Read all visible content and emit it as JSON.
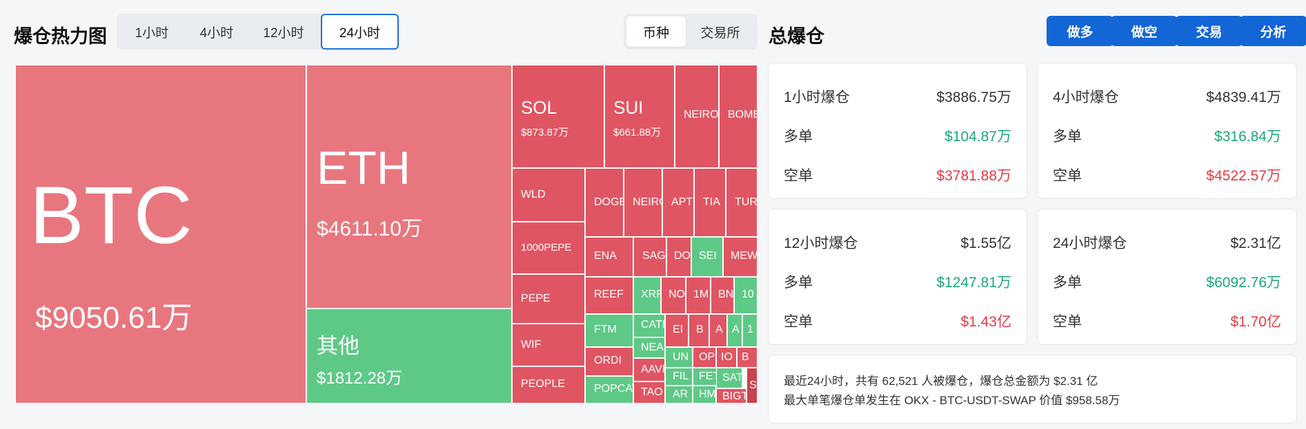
{
  "heatmap_title": "爆仓热力图",
  "time_tabs": [
    {
      "label": "1小时",
      "active": false
    },
    {
      "label": "4小时",
      "active": false
    },
    {
      "label": "12小时",
      "active": false
    },
    {
      "label": "24小时",
      "active": true
    }
  ],
  "group_tabs": [
    {
      "label": "币种",
      "active": true
    },
    {
      "label": "交易所",
      "active": false
    }
  ],
  "total_title": "总爆仓",
  "buttons": {
    "long": "做多",
    "short": "做空",
    "trade": "交易",
    "analyze": "分析"
  },
  "treemap": {
    "btc": {
      "symbol": "BTC",
      "amount": "$9050.61万"
    },
    "eth": {
      "symbol": "ETH",
      "amount": "$4611.10万"
    },
    "other": {
      "symbol": "其他",
      "amount": "$1812.28万"
    },
    "sol": {
      "symbol": "SOL",
      "amount": "$873.87万"
    },
    "sui": {
      "symbol": "SUI",
      "amount": "$661.88万"
    },
    "small": [
      "NEIRO",
      "BOME",
      "WLD",
      "1000PEPE",
      "PEPE",
      "WIF",
      "PEOPLE",
      "DOGE",
      "NEIRO",
      "APT",
      "TIA",
      "TURBO",
      "ENA",
      "SAGA",
      "DOGS",
      "SEI",
      "MEW",
      "REEF",
      "XRP",
      "NOT",
      "1M",
      "BNB",
      "10",
      "FTM",
      "CATI",
      "EI",
      "B",
      "A",
      "A",
      "1",
      "NEAR",
      "UN",
      "OP",
      "ORDI",
      "AAVE",
      "FIL",
      "FET",
      "IO",
      "B",
      "POPCAT",
      "TAO",
      "AR",
      "HM",
      "SATS",
      "BIGT",
      "S"
    ]
  },
  "stats": [
    {
      "period": "1小时爆仓",
      "total": "$3886.75万",
      "long_label": "多单",
      "long": "$104.87万",
      "short_label": "空单",
      "short": "$3781.88万"
    },
    {
      "period": "4小时爆仓",
      "total": "$4839.41万",
      "long_label": "多单",
      "long": "$316.84万",
      "short_label": "空单",
      "short": "$4522.57万"
    },
    {
      "period": "12小时爆仓",
      "total": "$1.55亿",
      "long_label": "多单",
      "long": "$1247.81万",
      "short_label": "空单",
      "short": "$1.43亿"
    },
    {
      "period": "24小时爆仓",
      "total": "$2.31亿",
      "long_label": "多单",
      "long": "$6092.76万",
      "short_label": "空单",
      "short": "$1.70亿"
    }
  ],
  "summary": {
    "line1": "最近24小时，共有 62,521 人被爆仓，爆仓总金额为 $2.31 亿",
    "line2": "最大单笔爆仓单发生在 OKX - BTC-USDT-SWAP 价值 $958.58万"
  },
  "colors": {
    "accent": "#1366d6",
    "long": "#1aa874",
    "short": "#e53945",
    "heat_red": "#e05563",
    "heat_pink": "#e8767f",
    "heat_green": "#5ec987"
  }
}
